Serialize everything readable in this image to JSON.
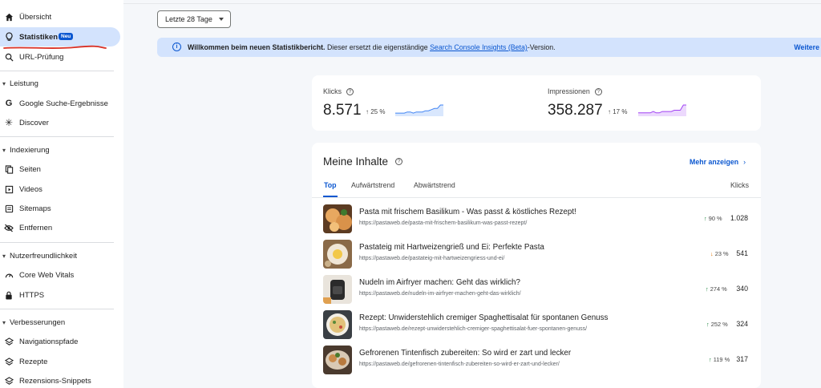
{
  "sidebar": {
    "overview": "Übersicht",
    "stats": "Statistiken",
    "stats_badge": "Neu",
    "url_check": "URL-Prüfung",
    "sections": {
      "performance": "Leistung",
      "indexing": "Indexierung",
      "experience": "Nutzerfreundlichkeit",
      "enhancements": "Verbesserungen"
    },
    "items": {
      "google_search": "Google Suche-Ergebnisse",
      "discover": "Discover",
      "pages": "Seiten",
      "videos": "Videos",
      "sitemaps": "Sitemaps",
      "removals": "Entfernen",
      "cwv": "Core Web Vitals",
      "https": "HTTPS",
      "breadcrumbs": "Navigationspfade",
      "recipes": "Rezepte",
      "review_snippets": "Rezensions-Snippets"
    }
  },
  "date_range": "Letzte 28 Tage",
  "banner": {
    "bold": "Willkommen beim neuen Statistikbericht.",
    "text": " Dieser ersetzt die eigenständige ",
    "link": "Search Console Insights (Beta)",
    "suffix": "-Version.",
    "more": "Weitere"
  },
  "metrics": {
    "clicks_label": "Klicks",
    "clicks_value": "8.571",
    "clicks_change": "25 %",
    "impressions_label": "Impressionen",
    "impressions_value": "358.287",
    "impressions_change": "17 %",
    "clicks_spark": [
      2,
      2,
      2,
      2,
      3,
      3,
      2,
      3,
      3,
      3,
      4,
      4,
      5,
      6,
      6,
      9,
      9
    ],
    "impressions_spark": [
      2,
      2,
      2,
      2,
      2,
      3,
      2,
      2,
      3,
      3,
      3,
      3,
      4,
      4,
      4,
      8,
      8
    ]
  },
  "content": {
    "title": "Meine Inhalte",
    "more": "Mehr anzeigen",
    "tabs": [
      "Top",
      "Aufwärtstrend",
      "Abwärtstrend"
    ],
    "col_clicks": "Klicks",
    "rows": [
      {
        "title": "Pasta mit frischem Basilikum - Was passt & köstliches Rezept!",
        "url": "https://pastaweb.de/pasta-mit-frischem-basilikum-was-passt-rezept/",
        "dir": "up",
        "trend": "90 %",
        "clicks": "1.028"
      },
      {
        "title": "Pastateig mit Hartweizengrieß und Ei: Perfekte Pasta",
        "url": "https://pastaweb.de/pastateig-mit-hartweizengriess-und-ei/",
        "dir": "down",
        "trend": "23 %",
        "clicks": "541"
      },
      {
        "title": "Nudeln im Airfryer machen: Geht das wirklich?",
        "url": "https://pastaweb.de/nudeln-im-airfryer-machen-geht-das-wirklich/",
        "dir": "up",
        "trend": "274 %",
        "clicks": "340"
      },
      {
        "title": "Rezept: Unwiderstehlich cremiger Spaghettisalat für spontanen Genuss",
        "url": "https://pastaweb.de/rezept-unwiderstehlich-cremiger-spaghettisalat-fuer-spontanen-genuss/",
        "dir": "up",
        "trend": "252 %",
        "clicks": "324"
      },
      {
        "title": "Gefrorenen Tintenfisch zubereiten: So wird er zart und lecker",
        "url": "https://pastaweb.de/gefrorenen-tintenfisch-zubereiten-so-wird-er-zart-und-lecker/",
        "dir": "up",
        "trend": "119 %",
        "clicks": "317"
      }
    ]
  },
  "colors": {
    "accent": "#0b57d0",
    "clicks_spark": "#4285f4",
    "impressions_spark": "#a142f4",
    "annotation": "#d93025"
  }
}
